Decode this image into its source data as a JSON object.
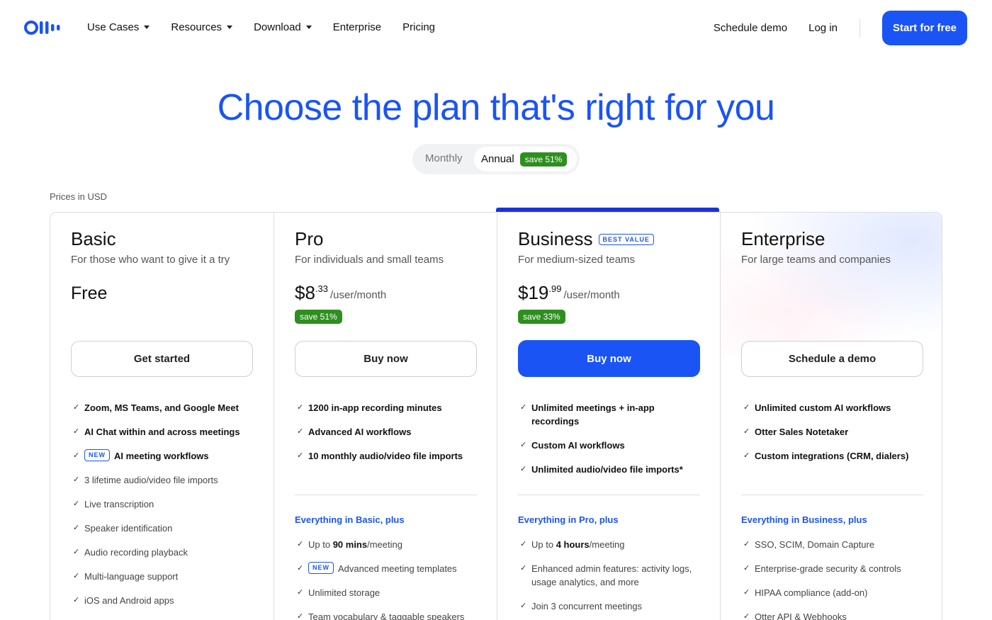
{
  "nav": {
    "logo_label": "Otter",
    "links": [
      {
        "label": "Use Cases",
        "caret": true
      },
      {
        "label": "Resources",
        "caret": true
      },
      {
        "label": "Download",
        "caret": true
      },
      {
        "label": "Enterprise",
        "caret": false
      },
      {
        "label": "Pricing",
        "caret": false
      }
    ],
    "schedule_demo": "Schedule demo",
    "login": "Log in",
    "start_free": "Start for free"
  },
  "hero": {
    "title": "Choose the plan that's right for you",
    "toggle_monthly": "Monthly",
    "toggle_annual": "Annual",
    "toggle_save": "save 51%",
    "prices_note": "Prices in USD"
  },
  "colors": {
    "brand_blue": "#1a54f5",
    "save_green": "#2e8f1f"
  },
  "plans": [
    {
      "name": "Basic",
      "subtitle": "For those who want to give it a try",
      "price_text": "Free",
      "cta": "Get started",
      "features": [
        {
          "text": "Zoom, MS Teams, and Google Meet",
          "bold": true
        },
        {
          "text": "AI Chat within and across meetings",
          "bold": true
        },
        {
          "text": "AI meeting workflows",
          "bold": true,
          "tag": "NEW"
        },
        {
          "text": "3 lifetime audio/video file imports",
          "bold": false
        },
        {
          "text": "Live transcription",
          "bold": false
        },
        {
          "text": "Speaker identification",
          "bold": false
        },
        {
          "text": "Audio recording playback",
          "bold": false
        },
        {
          "text": "Multi-language support",
          "bold": false
        },
        {
          "text": "iOS and Android apps",
          "bold": false
        }
      ]
    },
    {
      "name": "Pro",
      "subtitle": "For individuals and small teams",
      "price_main": "$8",
      "price_cents": ".33",
      "price_unit": "/user/month",
      "save": "save 51%",
      "cta": "Buy now",
      "features": [
        {
          "text": "1200 in-app recording minutes",
          "bold": true
        },
        {
          "text": "Advanced AI workflows",
          "bold": true
        },
        {
          "text": "10 monthly audio/video file imports",
          "bold": true
        }
      ],
      "plus_heading": "Everything in Basic, plus",
      "plus_features": [
        {
          "pre": "Up to ",
          "strong": "90 mins",
          "post": "/meeting"
        },
        {
          "text": "Advanced meeting templates",
          "tag": "NEW"
        },
        {
          "text": "Unlimited storage"
        },
        {
          "text": "Team vocabulary & taggable speakers"
        }
      ]
    },
    {
      "name": "Business",
      "badge": "BEST VALUE",
      "subtitle": "For medium-sized teams",
      "price_main": "$19",
      "price_cents": ".99",
      "price_unit": "/user/month",
      "save": "save 33%",
      "cta": "Buy now",
      "features": [
        {
          "text": "Unlimited meetings + in-app recordings",
          "bold": true
        },
        {
          "text": "Custom AI workflows",
          "bold": true
        },
        {
          "text": "Unlimited audio/video file imports*",
          "bold": true
        }
      ],
      "plus_heading": "Everything in Pro, plus",
      "plus_features": [
        {
          "pre": "Up to ",
          "strong": "4 hours",
          "post": "/meeting"
        },
        {
          "text": "Enhanced admin features: activity logs, usage analytics, and more"
        },
        {
          "text": "Join 3 concurrent meetings"
        }
      ]
    },
    {
      "name": "Enterprise",
      "subtitle": "For large teams and companies",
      "cta": "Schedule a demo",
      "features": [
        {
          "text": "Unlimited custom AI workflows",
          "bold": true
        },
        {
          "text": "Otter Sales Notetaker",
          "bold": true
        },
        {
          "text": "Custom integrations (CRM, dialers)",
          "bold": true
        }
      ],
      "plus_heading": "Everything in Business, plus",
      "plus_features": [
        {
          "text": "SSO, SCIM, Domain Capture"
        },
        {
          "text": "Enterprise-grade security & controls"
        },
        {
          "text": "HIPAA compliance (add-on)"
        },
        {
          "text": "Otter API & Webhooks"
        }
      ]
    }
  ]
}
